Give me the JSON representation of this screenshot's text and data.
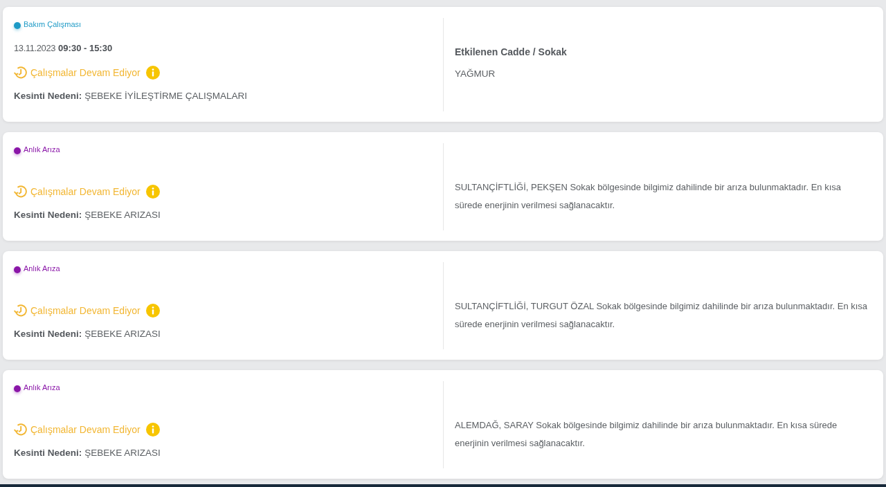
{
  "outages": [
    {
      "kind": "maintenance",
      "category": "Bakım Çalışması",
      "color": "#1e9ac6",
      "date": "13.11.2023",
      "time": "09:30 - 15:30",
      "status": "Çalışmalar Devam Ediyor",
      "reason_label": "Kesinti Nedeni:",
      "reason": "ŞEBEKE İYİLEŞTİRME ÇALIŞMALARI",
      "affected_heading": "Etkilenen Cadde / Sokak",
      "affected_streets": "YAĞMUR"
    },
    {
      "kind": "fault",
      "category": "Anlık Arıza",
      "color": "#8a16a8",
      "status": "Çalışmalar Devam Ediyor",
      "reason_label": "Kesinti Nedeni:",
      "reason": "ŞEBEKE ARIZASI",
      "description": "SULTANÇİFTLİĞİ, PEKŞEN Sokak bölgesinde bilgimiz dahilinde bir arıza bulunmaktadır. En kısa sürede enerjinin verilmesi sağlanacaktır."
    },
    {
      "kind": "fault",
      "category": "Anlık Arıza",
      "color": "#8a16a8",
      "status": "Çalışmalar Devam Ediyor",
      "reason_label": "Kesinti Nedeni:",
      "reason": "ŞEBEKE ARIZASI",
      "description": "SULTANÇİFTLİĞİ, TURGUT ÖZAL Sokak bölgesinde bilgimiz dahilinde bir arıza bulunmaktadır. En kısa sürede enerjinin verilmesi sağlanacaktır."
    },
    {
      "kind": "fault",
      "category": "Anlık Arıza",
      "color": "#8a16a8",
      "status": "Çalışmalar Devam Ediyor",
      "reason_label": "Kesinti Nedeni:",
      "reason": "ŞEBEKE ARIZASI",
      "description": "ALEMDAĞ, SARAY Sokak bölgesinde bilgimiz dahilinde bir arıza bulunmaktadır. En kısa sürede enerjinin verilmesi sağlanacaktır."
    }
  ]
}
